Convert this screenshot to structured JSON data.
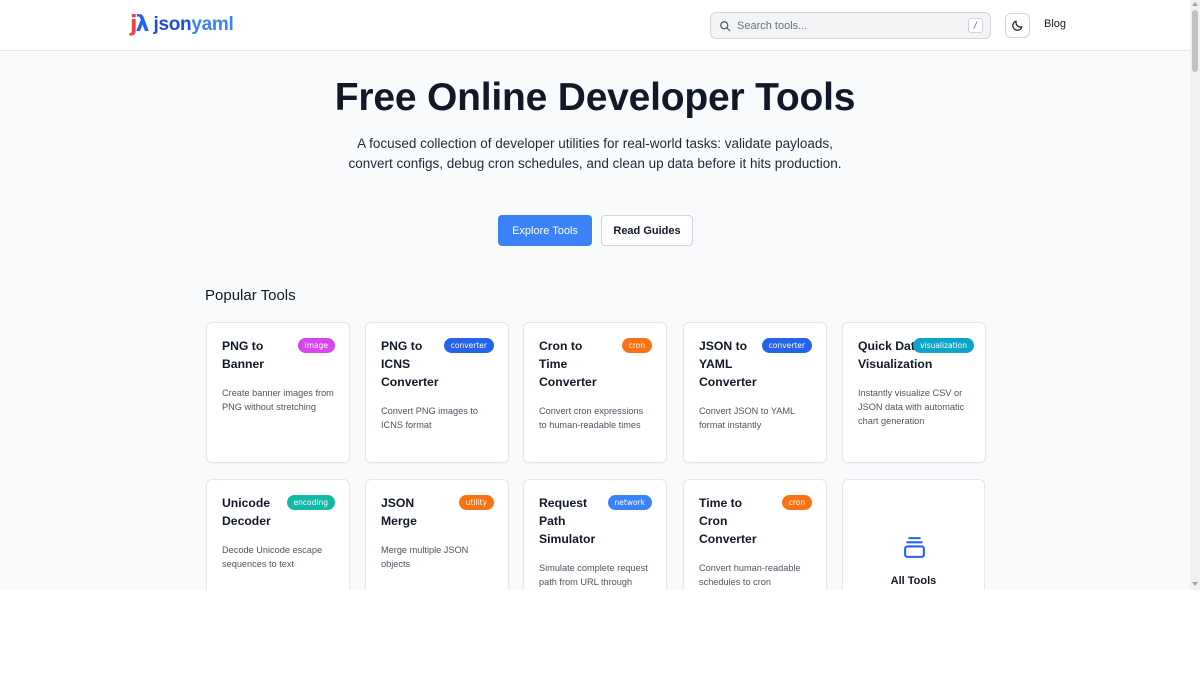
{
  "header": {
    "logo_mark_j": "j",
    "logo_mark_lambda": "λ",
    "logo_text_json": "json",
    "logo_text_yaml": "yaml",
    "search_placeholder": "Search tools...",
    "search_shortcut": "/",
    "theme_icon": "moon-icon",
    "blog_label": "Blog"
  },
  "hero": {
    "title": "Free Online Developer Tools",
    "subtitle": "A focused collection of developer utilities for real-world tasks: validate payloads, convert configs, debug cron schedules, and clean up data before it hits production.",
    "primary_button": "Explore Tools",
    "secondary_button": "Read Guides"
  },
  "popular": {
    "title": "Popular Tools",
    "tools": [
      {
        "title": "PNG to Banner",
        "badge": "image",
        "badge_color": "#d946ef",
        "desc": "Create banner images from PNG without stretching"
      },
      {
        "title": "PNG to ICNS Converter",
        "badge": "converter",
        "badge_color": "#2563eb",
        "desc": "Convert PNG images to ICNS format"
      },
      {
        "title": "Cron to Time Converter",
        "badge": "cron",
        "badge_color": "#f97316",
        "desc": "Convert cron expressions to human-readable times"
      },
      {
        "title": "JSON to YAML Converter",
        "badge": "converter",
        "badge_color": "#2563eb",
        "desc": "Convert JSON to YAML format instantly"
      },
      {
        "title": "Quick Data Visualization",
        "badge": "visualization",
        "badge_color": "#0ea5c6",
        "desc": "Instantly visualize CSV or JSON data with automatic chart generation"
      },
      {
        "title": "Unicode Decoder",
        "badge": "encoding",
        "badge_color": "#14b8a6",
        "desc": "Decode Unicode escape sequences to text"
      },
      {
        "title": "JSON Merge",
        "badge": "utility",
        "badge_color": "#f97316",
        "desc": "Merge multiple JSON objects"
      },
      {
        "title": "Request Path Simulator",
        "badge": "network",
        "badge_color": "#3b82f6",
        "desc": "Simulate complete request path from URL through DNS resolution, hosting"
      },
      {
        "title": "Time to Cron Converter",
        "badge": "cron",
        "badge_color": "#f97316",
        "desc": "Convert human-readable schedules to cron expressions"
      }
    ],
    "all_tools_label": "All Tools",
    "all_tools_icon": "stack-icon"
  }
}
